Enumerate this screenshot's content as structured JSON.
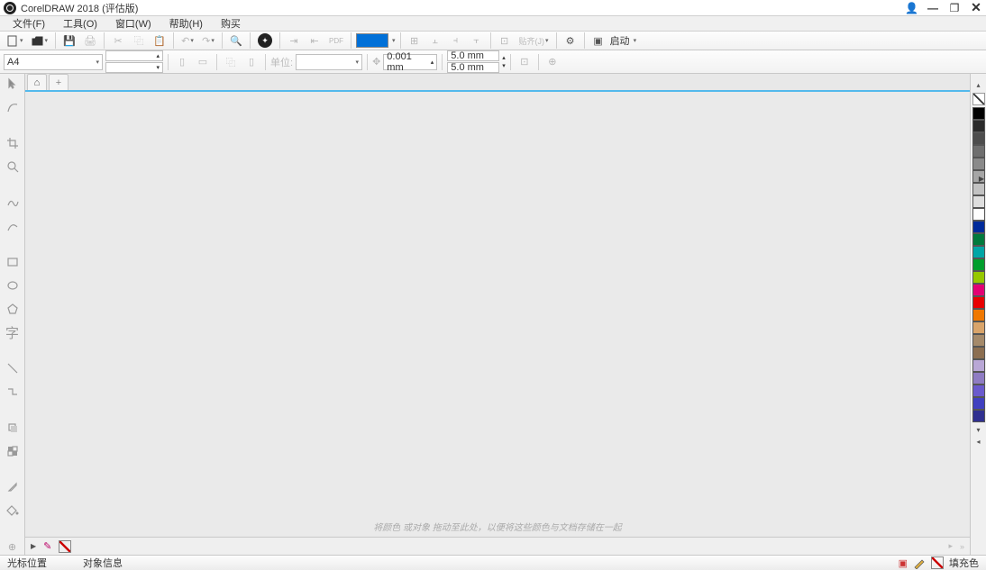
{
  "title": "CorelDRAW 2018 (评估版)",
  "menu": {
    "file": "文件(F)",
    "tools": "工具(O)",
    "window": "窗口(W)",
    "help": "帮助(H)",
    "buy": "购买"
  },
  "toolbar1": {
    "launch": "启动",
    "swatch_color": "#0070d8"
  },
  "toolbar2": {
    "paper": "A4",
    "nudge": "0.001 mm",
    "dup_x": "5.0 mm",
    "dup_y": "5.0 mm",
    "units": "单位:"
  },
  "hint": "将颜色 或对象 拖动至此处，以便将这些颜色与文档存储在一起",
  "status": {
    "cursor": "光标位置",
    "obj": "对象信息",
    "fill": "填充色"
  },
  "palette": [
    "#000000",
    "#2b2b2b",
    "#4d4d4d",
    "#6f6f6f",
    "#8a8a8a",
    "#a6a6a6",
    "#c2c2c2",
    "#dedede",
    "#ffffff",
    "#002b9b",
    "#007a3d",
    "#00a6a6",
    "#009e2d",
    "#96c800",
    "#e30074",
    "#e80000",
    "#f07800",
    "#d9a46a",
    "#a58a6a",
    "#8c6e50",
    "#b9a7d6",
    "#8f7cc3",
    "#6a5acd",
    "#4040c0",
    "#303090"
  ]
}
